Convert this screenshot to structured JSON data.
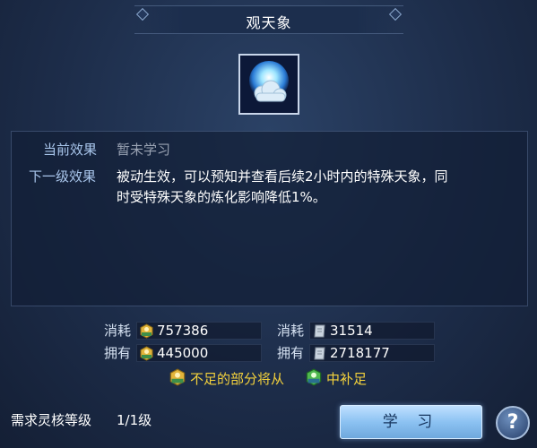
{
  "window": {
    "title": "观天象"
  },
  "skill": {
    "icon": "cloud-moon-icon"
  },
  "effects": {
    "current_label": "当前效果",
    "current_value": "暂未学习",
    "next_label": "下一级效果",
    "next_value_line1": "被动生效，可以预知并查看后续2小时内的特殊天象，同",
    "next_value_line2": "时受特殊天象的炼化影响降低1%。"
  },
  "costs": {
    "consume_label": "消耗",
    "own_label": "拥有",
    "currency_a": {
      "icon": "exp-coin-icon",
      "consume": "757386",
      "own": "445000"
    },
    "currency_b": {
      "icon": "scroll-icon",
      "consume": "31514",
      "own": "2718177"
    }
  },
  "notice": {
    "part1": "不足的部分将从",
    "part2": "中补足",
    "icon_left": "exp-coin-gold-icon",
    "icon_right": "exp-coin-green-icon"
  },
  "requirement": {
    "label": "需求灵核等级",
    "value": "1/1级"
  },
  "buttons": {
    "learn": "学 习",
    "help": "?"
  },
  "colors": {
    "label_blue": "#a9c6ec",
    "notice_yellow": "#f4d23c",
    "button_blue": "#8cc2f2"
  }
}
